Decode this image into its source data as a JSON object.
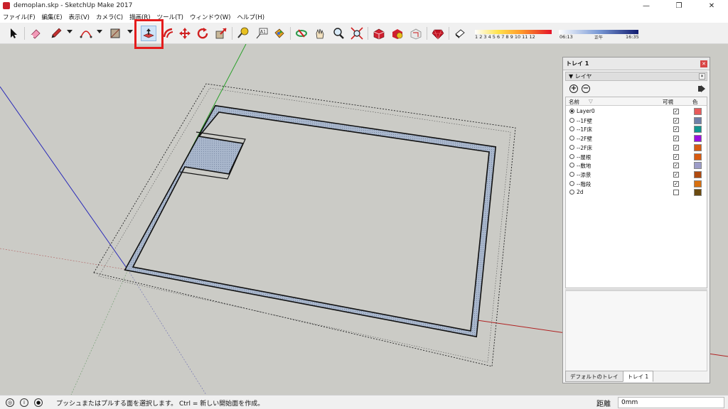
{
  "window": {
    "title": "demoplan.skp - SketchUp Make 2017",
    "minimize": "—",
    "restore": "❐",
    "close": "✕"
  },
  "menu": [
    "ファイル(F)",
    "編集(E)",
    "表示(V)",
    "カメラ(C)",
    "描画(R)",
    "ツール(T)",
    "ウィンドウ(W)",
    "ヘルプ(H)"
  ],
  "shadow": {
    "months": "1 2 3 4 5 6 7 8 9 10 11 12",
    "time_start": "06:13",
    "time_mid": "正午",
    "time_end": "16:35"
  },
  "tray": {
    "title": "トレイ 1",
    "layer_section": "▼ レイヤ",
    "col_name": "名前",
    "col_sort": "▽",
    "col_visible": "可視",
    "col_color": "色",
    "layers": [
      {
        "name": "Layer0",
        "active": true,
        "visible": true,
        "color": "#e85a5a"
      },
      {
        "name": "--1F壁",
        "active": false,
        "visible": true,
        "color": "#6f7fa8"
      },
      {
        "name": "--1F床",
        "active": false,
        "visible": true,
        "color": "#11958f"
      },
      {
        "name": "--2F壁",
        "active": false,
        "visible": true,
        "color": "#9a10e0"
      },
      {
        "name": "--2F床",
        "active": false,
        "visible": true,
        "color": "#d85a10"
      },
      {
        "name": "--屋根",
        "active": false,
        "visible": true,
        "color": "#d85a10"
      },
      {
        "name": "--敷地",
        "active": false,
        "visible": true,
        "color": "#9c9cc8"
      },
      {
        "name": "--添景",
        "active": false,
        "visible": true,
        "color": "#b04a10"
      },
      {
        "name": "--階段",
        "active": false,
        "visible": true,
        "color": "#d87010"
      },
      {
        "name": "2d",
        "active": false,
        "visible": false,
        "color": "#6a4a10"
      }
    ],
    "tabs": [
      "デフォルトのトレイ",
      "トレイ 1"
    ]
  },
  "status": {
    "message": "プッシュまたはプルする面を選択します。 Ctrl = 新しい開始面を作成。",
    "distance_label": "距離",
    "distance_value": "0mm"
  },
  "icons": {
    "select": "arrow-icon",
    "eraser": "eraser-icon",
    "pencil": "pencil-icon",
    "arc": "arc-icon",
    "rectangle": "rectangle-icon",
    "pushpull": "push-pull-icon",
    "offset": "offset-icon",
    "move": "move-icon",
    "rotate": "rotate-icon",
    "scale": "scale-icon",
    "tape": "tape-measure-icon",
    "text": "text-icon",
    "paint": "paint-bucket-icon",
    "orbit": "orbit-icon",
    "pan": "pan-icon",
    "zoom": "zoom-icon",
    "zoom_extents": "zoom-extents-icon",
    "warehouse": "3d-warehouse-icon",
    "extension": "extension-warehouse-icon",
    "layout": "layout-icon",
    "ruby": "ruby-icon",
    "shadow": "shadow-toggle-icon"
  },
  "colors": {
    "highlight": "#e41c1c",
    "viewport_bg": "#cbcbc6",
    "wall_fill": "#a9b7cc"
  }
}
